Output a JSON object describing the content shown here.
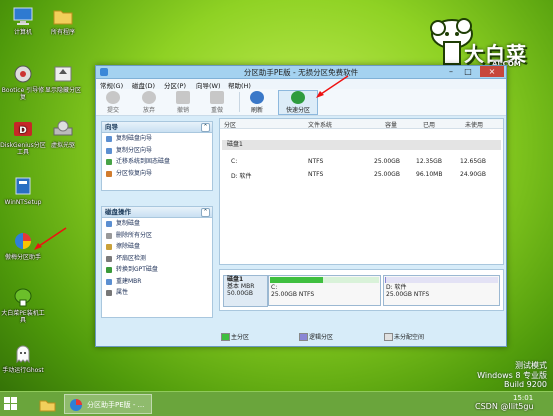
{
  "desktop": {
    "icons": [
      {
        "label": "计算机",
        "icon": "computer-icon"
      },
      {
        "label": "所有程序",
        "icon": "folder-icon"
      },
      {
        "label": "Bootice 引导修复",
        "icon": "bootice-icon"
      },
      {
        "label": "显示隐藏分区",
        "icon": "partition-toggle-icon"
      },
      {
        "label": "DiskGenius分区工具",
        "icon": "diskgenius-icon"
      },
      {
        "label": "虚拟光驱",
        "icon": "virtual-drive-icon"
      },
      {
        "label": "WinNTSetup",
        "icon": "winntsetup-icon"
      },
      {
        "label": "傲梅分区助手",
        "icon": "aomei-partition-icon"
      },
      {
        "label": "大白菜PE装机工具",
        "icon": "dabaicai-installer-icon"
      },
      {
        "label": "手动运行Ghost",
        "icon": "ghost-icon"
      }
    ],
    "logo_text": "大白菜",
    "logo_url": "AI.COM"
  },
  "window": {
    "title": "分区助手PE版 - 无损分区免费软件",
    "menu": [
      "常规(G)",
      "磁盘(D)",
      "分区(P)",
      "向导(W)",
      "帮助(H)"
    ],
    "toolbar": [
      {
        "label": "提交",
        "icon": "commit-icon"
      },
      {
        "label": "放弃",
        "icon": "discard-icon"
      },
      {
        "label": "撤销",
        "icon": "undo-icon"
      },
      {
        "label": "重做",
        "icon": "redo-icon"
      },
      {
        "label": "刷新",
        "icon": "refresh-icon"
      },
      {
        "label": "快速分区",
        "icon": "quick-partition-icon"
      }
    ],
    "wizard_panel": {
      "title": "向导",
      "items": [
        "复制磁盘向导",
        "复制分区向导",
        "迁移系统到固态磁盘",
        "分区恢复向导"
      ]
    },
    "disk_ops_panel": {
      "title": "磁盘操作",
      "items": [
        "复制磁盘",
        "删除所有分区",
        "擦除磁盘",
        "坏扇区检测",
        "转换到GPT磁盘",
        "重建MBR",
        "属性"
      ]
    },
    "table": {
      "headers": [
        "分区",
        "文件系统",
        "容量",
        "已用",
        "未使用"
      ],
      "disk_label": "磁盘1",
      "rows": [
        {
          "name": "C:",
          "fs": "NTFS",
          "capacity": "25.00GB",
          "used": "12.35GB",
          "free": "12.65GB"
        },
        {
          "name": "D: 软件",
          "fs": "NTFS",
          "capacity": "25.00GB",
          "used": "96.10MB",
          "free": "24.90GB"
        }
      ]
    },
    "disk_map": {
      "disk_name": "磁盘1",
      "disk_type": "基本 MBR",
      "disk_size": "50.00GB",
      "partitions": [
        {
          "name": "C:",
          "desc": "25.00GB NTFS",
          "fill": 0.49,
          "color": "#3fbf3f"
        },
        {
          "name": "D: 软件",
          "desc": "25.00GB NTFS",
          "fill": 0.01,
          "color": "#8a86d6"
        }
      ]
    },
    "legend": [
      {
        "label": "主分区",
        "color": "#3fbf3f"
      },
      {
        "label": "逻辑分区",
        "color": "#8a86d6"
      },
      {
        "label": "未分配空间",
        "color": "#e0e0e0"
      }
    ]
  },
  "taskbar": {
    "app_label": "分区助手PE版 - ..."
  },
  "watermark": {
    "line1": "测试模式",
    "line2": "Windows 8 专业版",
    "line3": "Build 9200",
    "time": "15:01",
    "csdn": "CSDN @Ilit5gu"
  }
}
